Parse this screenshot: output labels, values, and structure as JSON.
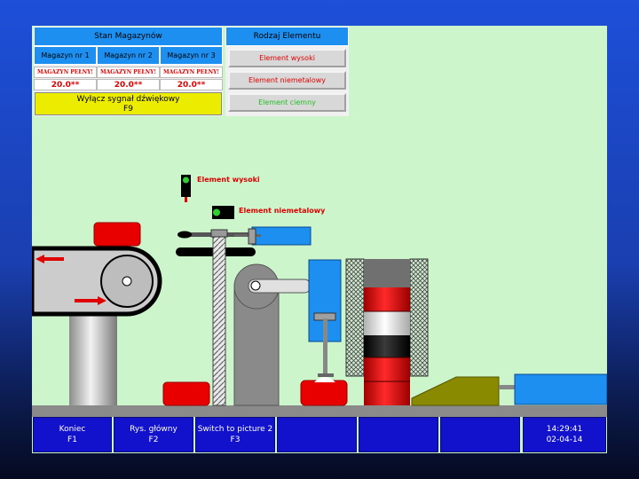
{
  "storage": {
    "title": "Stan Magazynów",
    "columns": [
      {
        "name": "Magazyn nr 1",
        "status": "MAGAZYN PEŁNY!",
        "value": "20.0**"
      },
      {
        "name": "Magazyn nr 2",
        "status": "MAGAZYN PEŁNY!",
        "value": "20.0**"
      },
      {
        "name": "Magazyn nr 3",
        "status": "MAGAZYN PEŁNY!",
        "value": "20.0**"
      }
    ],
    "mute_button": {
      "label": "Wyłącz sygnał dźwiękowy",
      "key": "F9"
    }
  },
  "element_type": {
    "title": "Rodzaj Elementu",
    "items": [
      {
        "label": "Element wysoki",
        "color": "#e00000"
      },
      {
        "label": "Element niemetalowy",
        "color": "#e00000"
      },
      {
        "label": "Element ciemny",
        "color": "#20c020"
      }
    ]
  },
  "sensors": {
    "high": "Element wysoki",
    "nonmetal": "Element niemetalowy"
  },
  "function_keys": [
    {
      "label": "Koniec",
      "key": "F1"
    },
    {
      "label": "Rys. główny",
      "key": "F2"
    },
    {
      "label": "Switch to picture 2",
      "key": "F3"
    },
    {
      "label": "",
      "key": ""
    },
    {
      "label": "",
      "key": ""
    },
    {
      "label": "",
      "key": ""
    }
  ],
  "clock": {
    "time": "14:29:41",
    "date": "02-04-14"
  },
  "colors": {
    "accent": "#1c8ff0",
    "alarm": "#e00000",
    "background": "#ccf5cc",
    "function_bar": "#1212cc"
  }
}
